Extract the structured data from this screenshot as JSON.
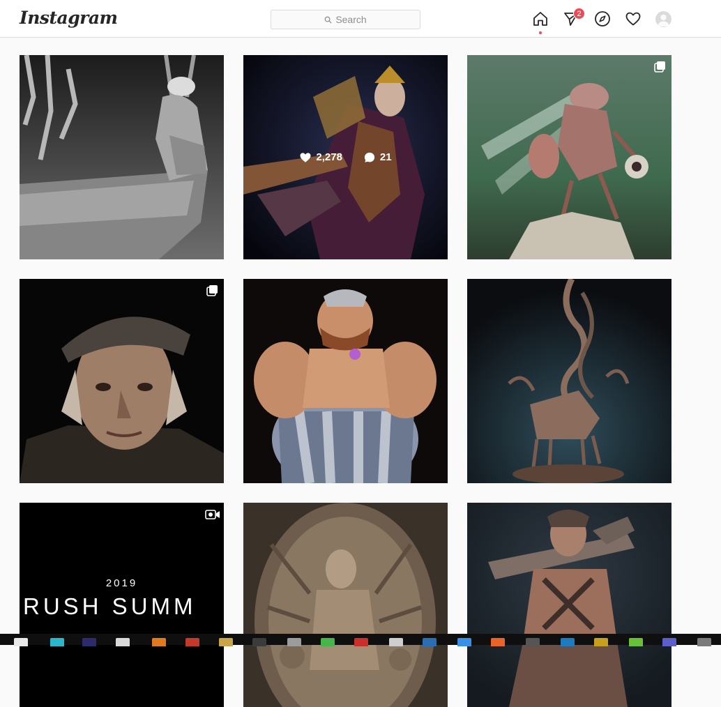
{
  "header": {
    "logo": "Instagram",
    "search_placeholder": "Search",
    "messages_badge": "2",
    "icons": [
      "home-icon",
      "direct-message-icon",
      "explore-icon",
      "activity-heart-icon",
      "profile-avatar"
    ]
  },
  "colors": {
    "badge": "#ed4956",
    "border": "#dbdbdb",
    "background": "#fafafa"
  },
  "grid": {
    "tiles": [
      {
        "id": "fisherman-sculpt",
        "badge": "none"
      },
      {
        "id": "warrior-queen",
        "badge": "none",
        "hover": {
          "likes": "2,278",
          "comments": "21"
        }
      },
      {
        "id": "insect-creature",
        "badge": "carousel"
      },
      {
        "id": "old-man-portrait",
        "badge": "carousel"
      },
      {
        "id": "obelix-character",
        "badge": "none"
      },
      {
        "id": "deer-sculpture",
        "badge": "none"
      },
      {
        "id": "zbrush-summit",
        "badge": "video",
        "text_year": "2019",
        "text_title": "BRUSH SUMM"
      },
      {
        "id": "goddess-relief",
        "badge": "none"
      },
      {
        "id": "gunner-woman",
        "badge": "none"
      }
    ]
  },
  "taskbar": {
    "icons": [
      "start-icon",
      "app-icon",
      "app-icon",
      "camera-icon",
      "app-icon",
      "app-icon",
      "app-icon",
      "app-icon",
      "app-icon",
      "app-icon",
      "app-icon",
      "app-icon",
      "app-icon",
      "app-icon",
      "app-icon",
      "app-icon",
      "app-icon",
      "app-icon",
      "app-icon",
      "app-icon",
      "app-icon"
    ]
  }
}
